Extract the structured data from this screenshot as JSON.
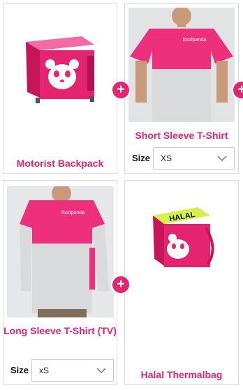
{
  "products": [
    {
      "title": "Motorist Backpack"
    },
    {
      "title": "Short Sleeve T-Shirt",
      "size_label": "Size",
      "size_value": "XS"
    },
    {
      "title": "Long Sleeve T-Shirt (TV)",
      "size_label": "Size",
      "size_value": "xS"
    },
    {
      "title": "Halal Thermalbag",
      "bag_label": "HALAL"
    }
  ],
  "plus_symbol": "+",
  "colors": {
    "accent": "#e5246f",
    "shirt_gray": "#d9dadb",
    "background": "#ffffff"
  }
}
